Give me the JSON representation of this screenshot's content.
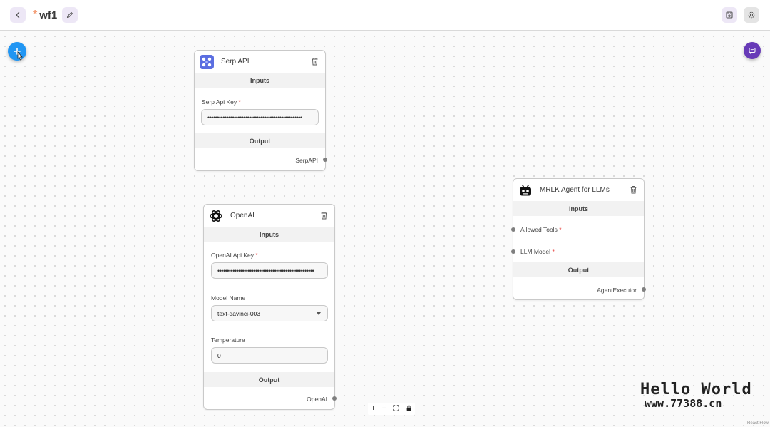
{
  "header": {
    "title": "wf1",
    "unsaved_marker": "*"
  },
  "icons": {
    "back": "chevron-left-icon",
    "edit": "pencil-icon",
    "save": "save-icon",
    "settings": "gear-icon",
    "add": "plus-icon",
    "chat": "chat-icon"
  },
  "nodes": {
    "serp": {
      "title": "Serp API",
      "inputs_label": "Inputs",
      "api_key_label": "Serp Api Key",
      "api_key_value": "••••••••••••••••••••••••••••••••••••••••••••••••••",
      "output_label": "Output",
      "output_name": "SerpAPI"
    },
    "openai": {
      "title": "OpenAI",
      "inputs_label": "Inputs",
      "api_key_label": "OpenAI Api Key",
      "api_key_value": "•••••••••••••••••••••••••••••••••••••••••••••••••••",
      "model_label": "Model Name",
      "model_value": "text-davinci-003",
      "temperature_label": "Temperature",
      "temperature_value": "0",
      "output_label": "Output",
      "output_name": "OpenAI"
    },
    "mrlk": {
      "title": "MRLK Agent for LLMs",
      "inputs_label": "Inputs",
      "allowed_tools_label": "Allowed Tools",
      "llm_model_label": "LLM Model",
      "output_label": "Output",
      "output_name": "AgentExecutor"
    }
  },
  "required_marker": "*",
  "controls": {
    "zoom_in": "+",
    "zoom_out": "−",
    "fit": "⛶",
    "lock": "🔒"
  },
  "watermark": {
    "title": "Hello World",
    "url": "www.77388.cn"
  },
  "attribution": "React Flow",
  "colors": {
    "primary": "#2196f3",
    "secondary": "#673ab7",
    "required": "#e53935"
  }
}
